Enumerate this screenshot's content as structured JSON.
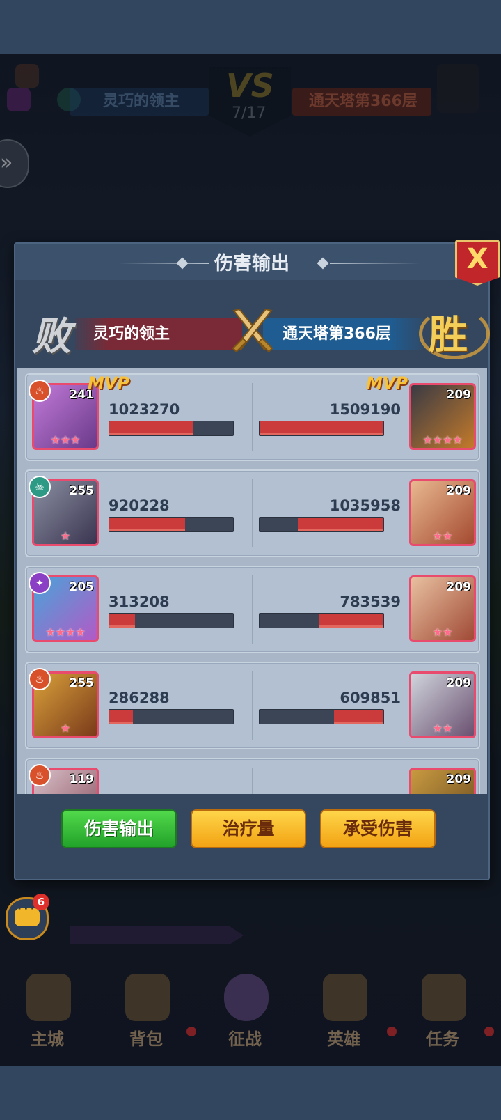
{
  "battle_header": {
    "left_team": "灵巧的领主",
    "right_team": "通天塔第366层",
    "vs_label": "VS",
    "round": "7/17"
  },
  "dialog": {
    "title": "伤害输出",
    "close_label": "X",
    "result": {
      "left_result": "败",
      "right_result": "胜",
      "left_team": "灵巧的领主",
      "right_team": "通天塔第366层"
    }
  },
  "rows": [
    {
      "left": {
        "level": "241",
        "damage": "1023270",
        "mvp": "MVP",
        "faction": "fire",
        "ratio": 0.68,
        "stars": "★★★"
      },
      "right": {
        "level": "209",
        "damage": "1509190",
        "mvp": "MVP",
        "faction": "none",
        "ratio": 1.0,
        "stars": "★★★★"
      }
    },
    {
      "left": {
        "level": "255",
        "damage": "920228",
        "mvp": "",
        "faction": "skull",
        "ratio": 0.61,
        "stars": "★"
      },
      "right": {
        "level": "209",
        "damage": "1035958",
        "mvp": "",
        "faction": "none",
        "ratio": 0.69,
        "stars": "★★"
      }
    },
    {
      "left": {
        "level": "205",
        "damage": "313208",
        "mvp": "",
        "faction": "arcane",
        "ratio": 0.21,
        "stars": "★★★★"
      },
      "right": {
        "level": "209",
        "damage": "783539",
        "mvp": "",
        "faction": "none",
        "ratio": 0.52,
        "stars": "★★"
      }
    },
    {
      "left": {
        "level": "255",
        "damage": "286288",
        "mvp": "",
        "faction": "fire",
        "ratio": 0.19,
        "stars": "★"
      },
      "right": {
        "level": "209",
        "damage": "609851",
        "mvp": "",
        "faction": "none",
        "ratio": 0.4,
        "stars": "★★"
      }
    },
    {
      "left": {
        "level": "119",
        "damage": "",
        "mvp": "",
        "faction": "fire",
        "ratio": 0,
        "stars": ""
      },
      "right": {
        "level": "209",
        "damage": "",
        "mvp": "",
        "faction": "none",
        "ratio": 0,
        "stars": ""
      }
    }
  ],
  "tabs": [
    {
      "label": "伤害输出",
      "active": true
    },
    {
      "label": "治疗量",
      "active": false
    },
    {
      "label": "承受伤害",
      "active": false
    }
  ],
  "chat": {
    "badge": "6"
  },
  "bottom_nav": [
    {
      "label": "主城",
      "icon": "castle-icon"
    },
    {
      "label": "背包",
      "icon": "backpack-icon"
    },
    {
      "label": "征战",
      "icon": "portal-icon"
    },
    {
      "label": "英雄",
      "icon": "hero-icon"
    },
    {
      "label": "任务",
      "icon": "scroll-icon"
    }
  ],
  "colors": {
    "accent_red": "#cc3b3b",
    "tab_active": "#22a22a",
    "tab_inactive": "#f2a313",
    "mvp_gold": "#f6c13b"
  }
}
